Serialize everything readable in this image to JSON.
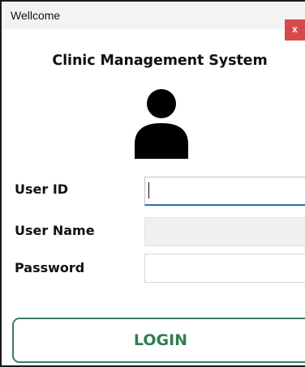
{
  "window": {
    "title": "Wellcome",
    "close_label": "x",
    "close_color": "#d54b4b"
  },
  "header": {
    "app_title": "Clinic Management System"
  },
  "avatar": {
    "icon": "user-silhouette-icon"
  },
  "form": {
    "user_id": {
      "label": "User ID",
      "value": ""
    },
    "user_name": {
      "label": "User Name",
      "value": ""
    },
    "password": {
      "label": "Password",
      "value": ""
    }
  },
  "actions": {
    "login_label": "LOGIN",
    "login_color": "#2f7d4e"
  }
}
